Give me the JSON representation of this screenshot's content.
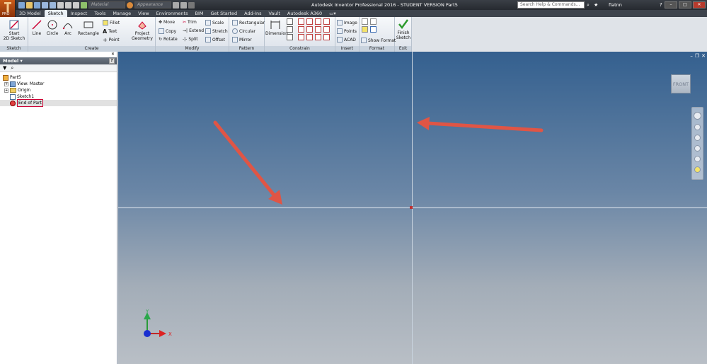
{
  "app": {
    "title": "Autodesk Inventor Professional 2016 - STUDENT VERSION   Part5",
    "badge": "PRO"
  },
  "qat": {
    "material": "Material",
    "appearance": "Appearance"
  },
  "search": {
    "placeholder": "Search Help & Commands..."
  },
  "user": {
    "name": "flatnn"
  },
  "tabs": [
    "3D Model",
    "Sketch",
    "Inspect",
    "Tools",
    "Manage",
    "View",
    "Environments",
    "BIM",
    "Get Started",
    "Add-Ins",
    "Vault",
    "Autodesk A360"
  ],
  "active_tab": "Sketch",
  "ribbon": {
    "sketch": {
      "title": "Sketch",
      "start": "Start",
      "start2": "2D Sketch"
    },
    "create": {
      "title": "Create",
      "line": "Line",
      "circle": "Circle",
      "arc": "Arc",
      "rectangle": "Rectangle",
      "fillet": "Fillet",
      "text": "Text",
      "point": "Point",
      "project1": "Project",
      "project2": "Geometry"
    },
    "modify": {
      "title": "Modify",
      "move": "Move",
      "copy": "Copy",
      "rotate": "Rotate",
      "trim": "Trim",
      "extend": "Extend",
      "split": "Split",
      "scale": "Scale",
      "stretch": "Stretch",
      "offset": "Offset"
    },
    "pattern": {
      "title": "Pattern",
      "rectangular": "Rectangular",
      "circular": "Circular",
      "mirror": "Mirror"
    },
    "constrain": {
      "title": "Constrain",
      "dimension": "Dimension"
    },
    "insert": {
      "title": "Insert",
      "image": "Image",
      "points": "Points",
      "acad": "ACAD"
    },
    "format": {
      "title": "Format",
      "show_format": "Show Format"
    },
    "exit": {
      "title": "Exit",
      "finish1": "Finish",
      "finish2": "Sketch"
    }
  },
  "browser": {
    "title": "Model",
    "tree": [
      {
        "label": "Part5",
        "icon": "part"
      },
      {
        "label": "View: Master",
        "icon": "view"
      },
      {
        "label": "Origin",
        "icon": "folder"
      },
      {
        "label": "Sketch1",
        "icon": "sketch"
      },
      {
        "label": "End of Part",
        "icon": "end-of-part"
      }
    ]
  },
  "viewport": {
    "viewcube": "FRONT",
    "triad_x": "X",
    "triad_y": "Y"
  },
  "colors": {
    "titlebar": "#2f343b",
    "ribbon": "#e9eef4",
    "viewport_top": "#34608f",
    "viewport_bottom": "#b9bfc6",
    "arrow": "#e05545"
  }
}
